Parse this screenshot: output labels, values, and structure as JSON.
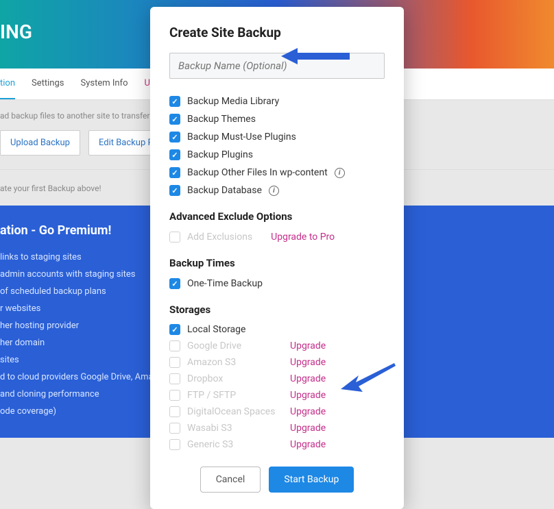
{
  "bg": {
    "header_text": "ING",
    "tabs": {
      "t0": "tion",
      "t1": "Settings",
      "t2": "System Info",
      "t3": "Upg"
    },
    "help": "ad backup files to another site to transfer a wel",
    "upload_btn": "Upload Backup",
    "edit_btn": "Edit Backup Plans",
    "first_backup": "ate your first Backup above!",
    "premium": {
      "title": "ation - Go Premium!",
      "li0": "links to staging sites",
      "li1": "admin accounts with staging sites",
      "li2": "of scheduled backup plans",
      "li3": "r websites",
      "li4": "her hosting provider",
      "li5": "her domain",
      "li6": "sites",
      "li7": "d to cloud providers Google Drive, Amazon S",
      "li8": "and cloning performance",
      "li9": "ode coverage)"
    }
  },
  "modal": {
    "title": "Create Site Backup",
    "name_placeholder": "Backup Name (Optional)",
    "opts": {
      "o0": "Backup Media Library",
      "o1": "Backup Themes",
      "o2": "Backup Must-Use Plugins",
      "o3": "Backup Plugins",
      "o4": "Backup Other Files In wp-content",
      "o5": "Backup Database"
    },
    "adv_h": "Advanced Exclude Options",
    "add_excl": "Add Exclusions",
    "upgrade_pro": "Upgrade to Pro",
    "times_h": "Backup Times",
    "one_time": "One-Time Backup",
    "storages_h": "Storages",
    "storages": {
      "s0": "Local Storage",
      "s1": "Google Drive",
      "s2": "Amazon S3",
      "s3": "Dropbox",
      "s4": "FTP / SFTP",
      "s5": "DigitalOcean Spaces",
      "s6": "Wasabi S3",
      "s7": "Generic S3"
    },
    "upgrade": "Upgrade",
    "cancel": "Cancel",
    "start": "Start Backup"
  }
}
